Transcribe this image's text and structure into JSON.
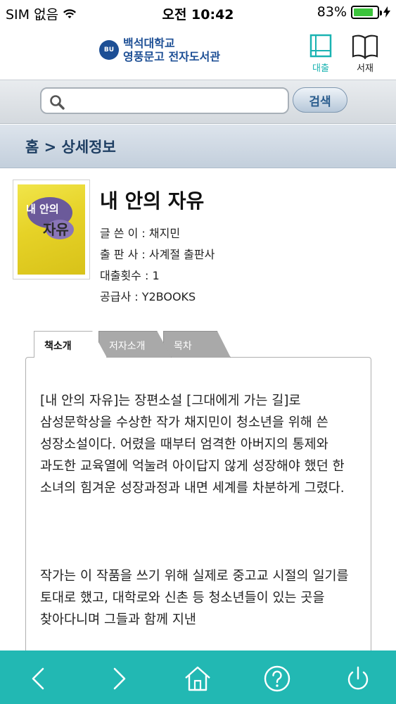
{
  "status_bar": {
    "carrier": "SIM 없음",
    "time": "오전 10:42",
    "battery": "83%",
    "battery_level": 0.83,
    "wifi_icon": "wifi-icon",
    "charging_icon": "charging-bolt-icon"
  },
  "header": {
    "logo_emblem": "BU",
    "logo_line1": "백석대학교",
    "logo_line2": "영풍문고 전자도서관",
    "loan_label": "대출",
    "shelf_label": "서재"
  },
  "search": {
    "placeholder": "",
    "value": "",
    "button_label": "검색"
  },
  "breadcrumb": "홈 > 상세정보",
  "book": {
    "cover_title": "내 안의",
    "cover_sub": "자유",
    "title": "내 안의 자유",
    "author": "글 쓴 이 : 채지민",
    "publisher": "출 판 사 : 사계절 출판사",
    "loan_count": "대출횟수 : 1",
    "supplier": "공급사 : Y2BOOKS"
  },
  "tabs": [
    "책소개",
    "저자소개",
    "목차"
  ],
  "active_tab": 0,
  "content": {
    "para1": "[내 안의 자유]는 장편소설 [그대에게 가는 길]로 삼성문학상을 수상한 작가 채지민이 청소년을 위해 쓴 성장소설이다. 어렸을 때부터 엄격한 아버지의 통제와 과도한 교육열에 억눌려 아이답지 않게 성장해야 했던 한 소녀의 힘겨운 성장과정과 내면 세계를 차분하게 그렸다.",
    "para2": "작가는 이 작품을 쓰기 위해 실제로 중고교 시절의 일기를 토대로 했고, 대학로와 신촌 등 청소년들이 있는 곳을 찾아다니며 그들과 함께 지낸"
  },
  "toolbar": {
    "items": [
      "back-icon",
      "forward-icon",
      "home-icon",
      "help-icon",
      "power-icon"
    ]
  },
  "colors": {
    "accent": "#22b8b3",
    "brand": "#1d4f95"
  }
}
